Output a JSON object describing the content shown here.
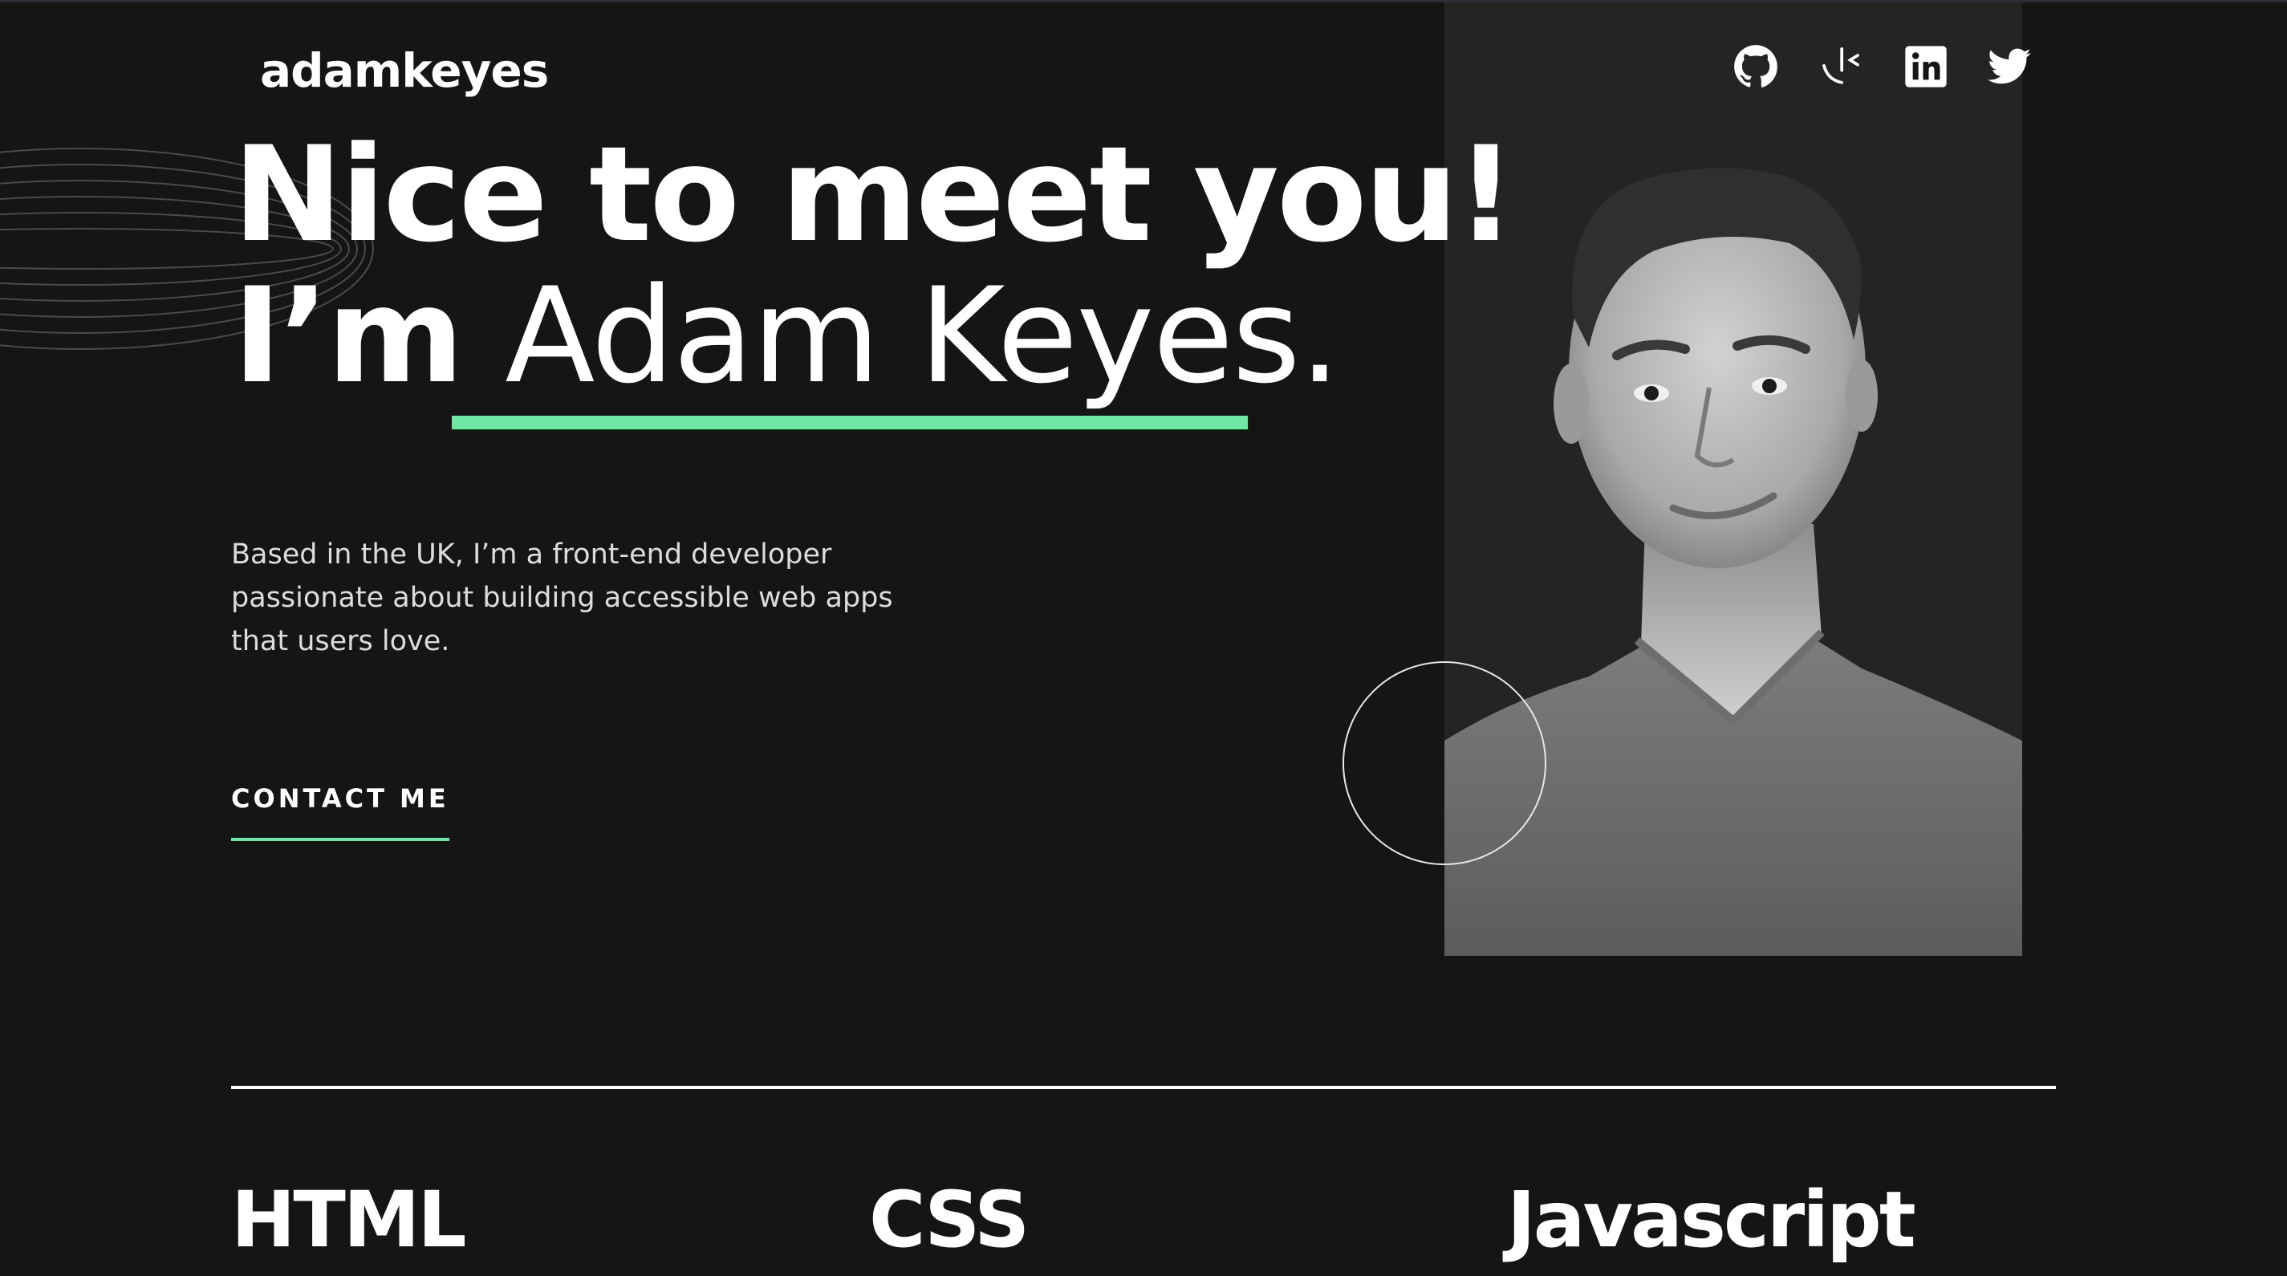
{
  "header": {
    "brand": "adamkeyes",
    "social_links": [
      {
        "name": "github",
        "icon": "github-icon"
      },
      {
        "name": "frontend-mentor",
        "icon": "frontend-mentor-icon"
      },
      {
        "name": "linkedin",
        "icon": "linkedin-icon"
      },
      {
        "name": "twitter",
        "icon": "twitter-icon"
      }
    ]
  },
  "hero": {
    "title_line_1": "Nice to meet you!",
    "title_prefix": "I’m ",
    "title_name": "Adam Keyes.",
    "intro": "Based in the UK, I’m a front-end developer passionate about building accessible web apps that users love.",
    "cta_label": "CONTACT ME",
    "portrait": "portrait-photo"
  },
  "skills": [
    {
      "name": "HTML"
    },
    {
      "name": "CSS"
    },
    {
      "name": "Javascript"
    }
  ],
  "colors": {
    "background": "#151515",
    "panel": "#242424",
    "accent": "#6ee7a2",
    "text": "#ffffff",
    "body_text": "#dcdcdc"
  }
}
